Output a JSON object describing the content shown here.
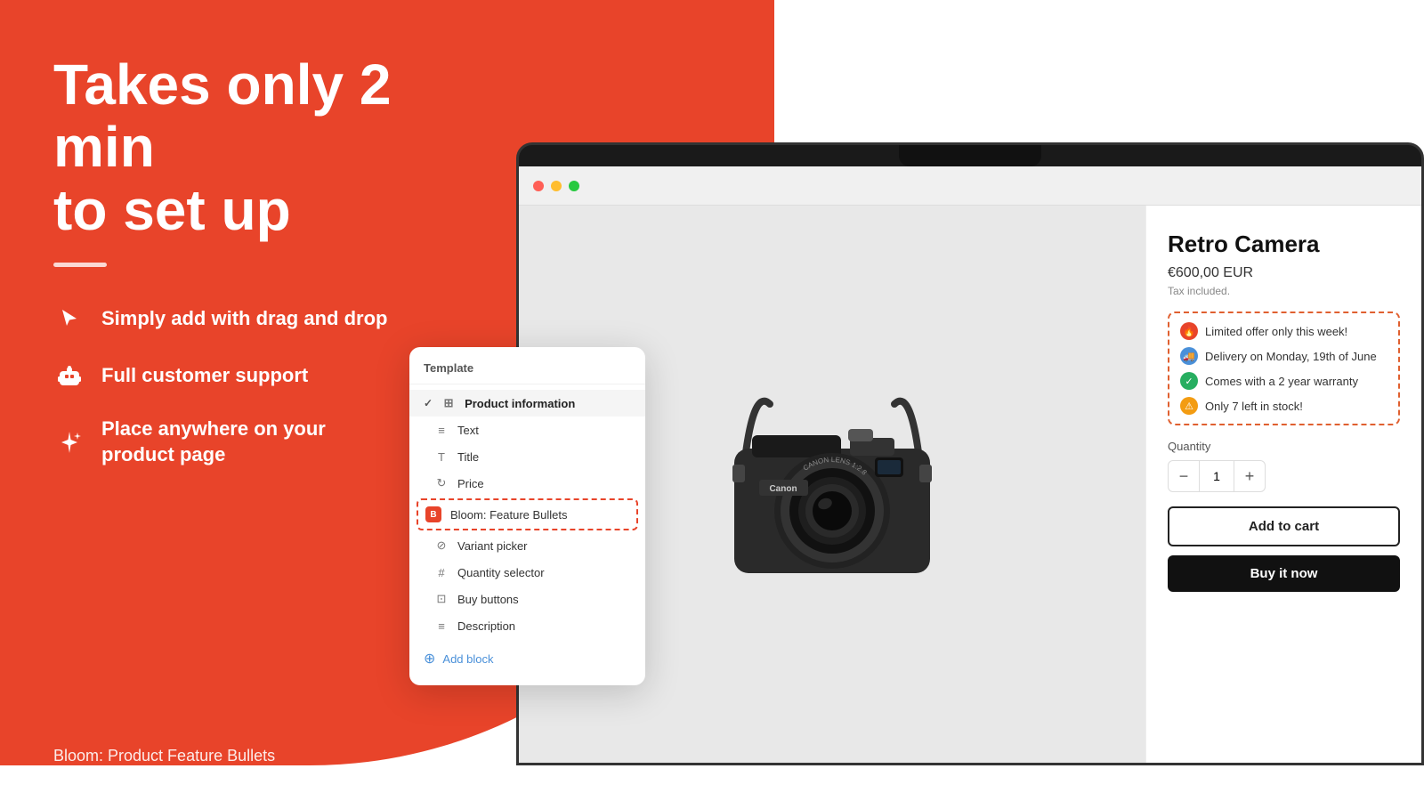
{
  "page": {
    "bg_color": "#E8442A"
  },
  "left": {
    "headline_line1": "Takes only 2 min",
    "headline_line2": "to set up",
    "features": [
      {
        "id": "drag-drop",
        "icon": "cursor",
        "text": "Simply add with drag and drop"
      },
      {
        "id": "support",
        "icon": "robot",
        "text": "Full customer support"
      },
      {
        "id": "place",
        "icon": "sparkle",
        "text": "Place anywhere on your product page"
      }
    ],
    "bottom_label": "Bloom: Product Feature Bullets"
  },
  "template_panel": {
    "title": "Template",
    "items": [
      {
        "id": "product-information",
        "icon": "grid",
        "label": "Product information",
        "active": true,
        "indent": false
      },
      {
        "id": "text",
        "icon": "lines",
        "label": "Text",
        "indent": true
      },
      {
        "id": "title",
        "icon": "T",
        "label": "Title",
        "indent": true
      },
      {
        "id": "price",
        "icon": "sync",
        "label": "Price",
        "indent": true
      },
      {
        "id": "bloom-feature",
        "icon": "B",
        "label": "Bloom: Feature Bullets",
        "highlighted": true,
        "indent": true
      },
      {
        "id": "variant-picker",
        "icon": "circle-slash",
        "label": "Variant picker",
        "indent": true
      },
      {
        "id": "quantity-selector",
        "icon": "hash",
        "label": "Quantity selector",
        "indent": true
      },
      {
        "id": "buy-buttons",
        "icon": "monitor",
        "label": "Buy buttons",
        "indent": true
      },
      {
        "id": "description",
        "icon": "lines",
        "label": "Description",
        "indent": true
      }
    ],
    "add_block_label": "Add block"
  },
  "product": {
    "title": "Retro Camera",
    "price": "€600,00 EUR",
    "tax_note": "Tax included.",
    "bullets": [
      {
        "id": "limited-offer",
        "icon": "fire",
        "color": "red",
        "text": "Limited offer only this week!"
      },
      {
        "id": "delivery",
        "icon": "truck",
        "color": "blue",
        "text": "Delivery on Monday, 19th of June"
      },
      {
        "id": "warranty",
        "icon": "check",
        "color": "green",
        "text": "Comes with a 2 year warranty"
      },
      {
        "id": "stock",
        "icon": "warning",
        "color": "orange",
        "text": "Only 7 left in stock!"
      }
    ],
    "quantity_label": "Quantity",
    "quantity_value": "1",
    "quantity_minus": "−",
    "quantity_plus": "+",
    "add_to_cart": "Add to cart",
    "buy_now": "Buy it now"
  },
  "browser": {
    "dot_colors": [
      "#FF5F56",
      "#FFBD2E",
      "#27C93F"
    ]
  }
}
